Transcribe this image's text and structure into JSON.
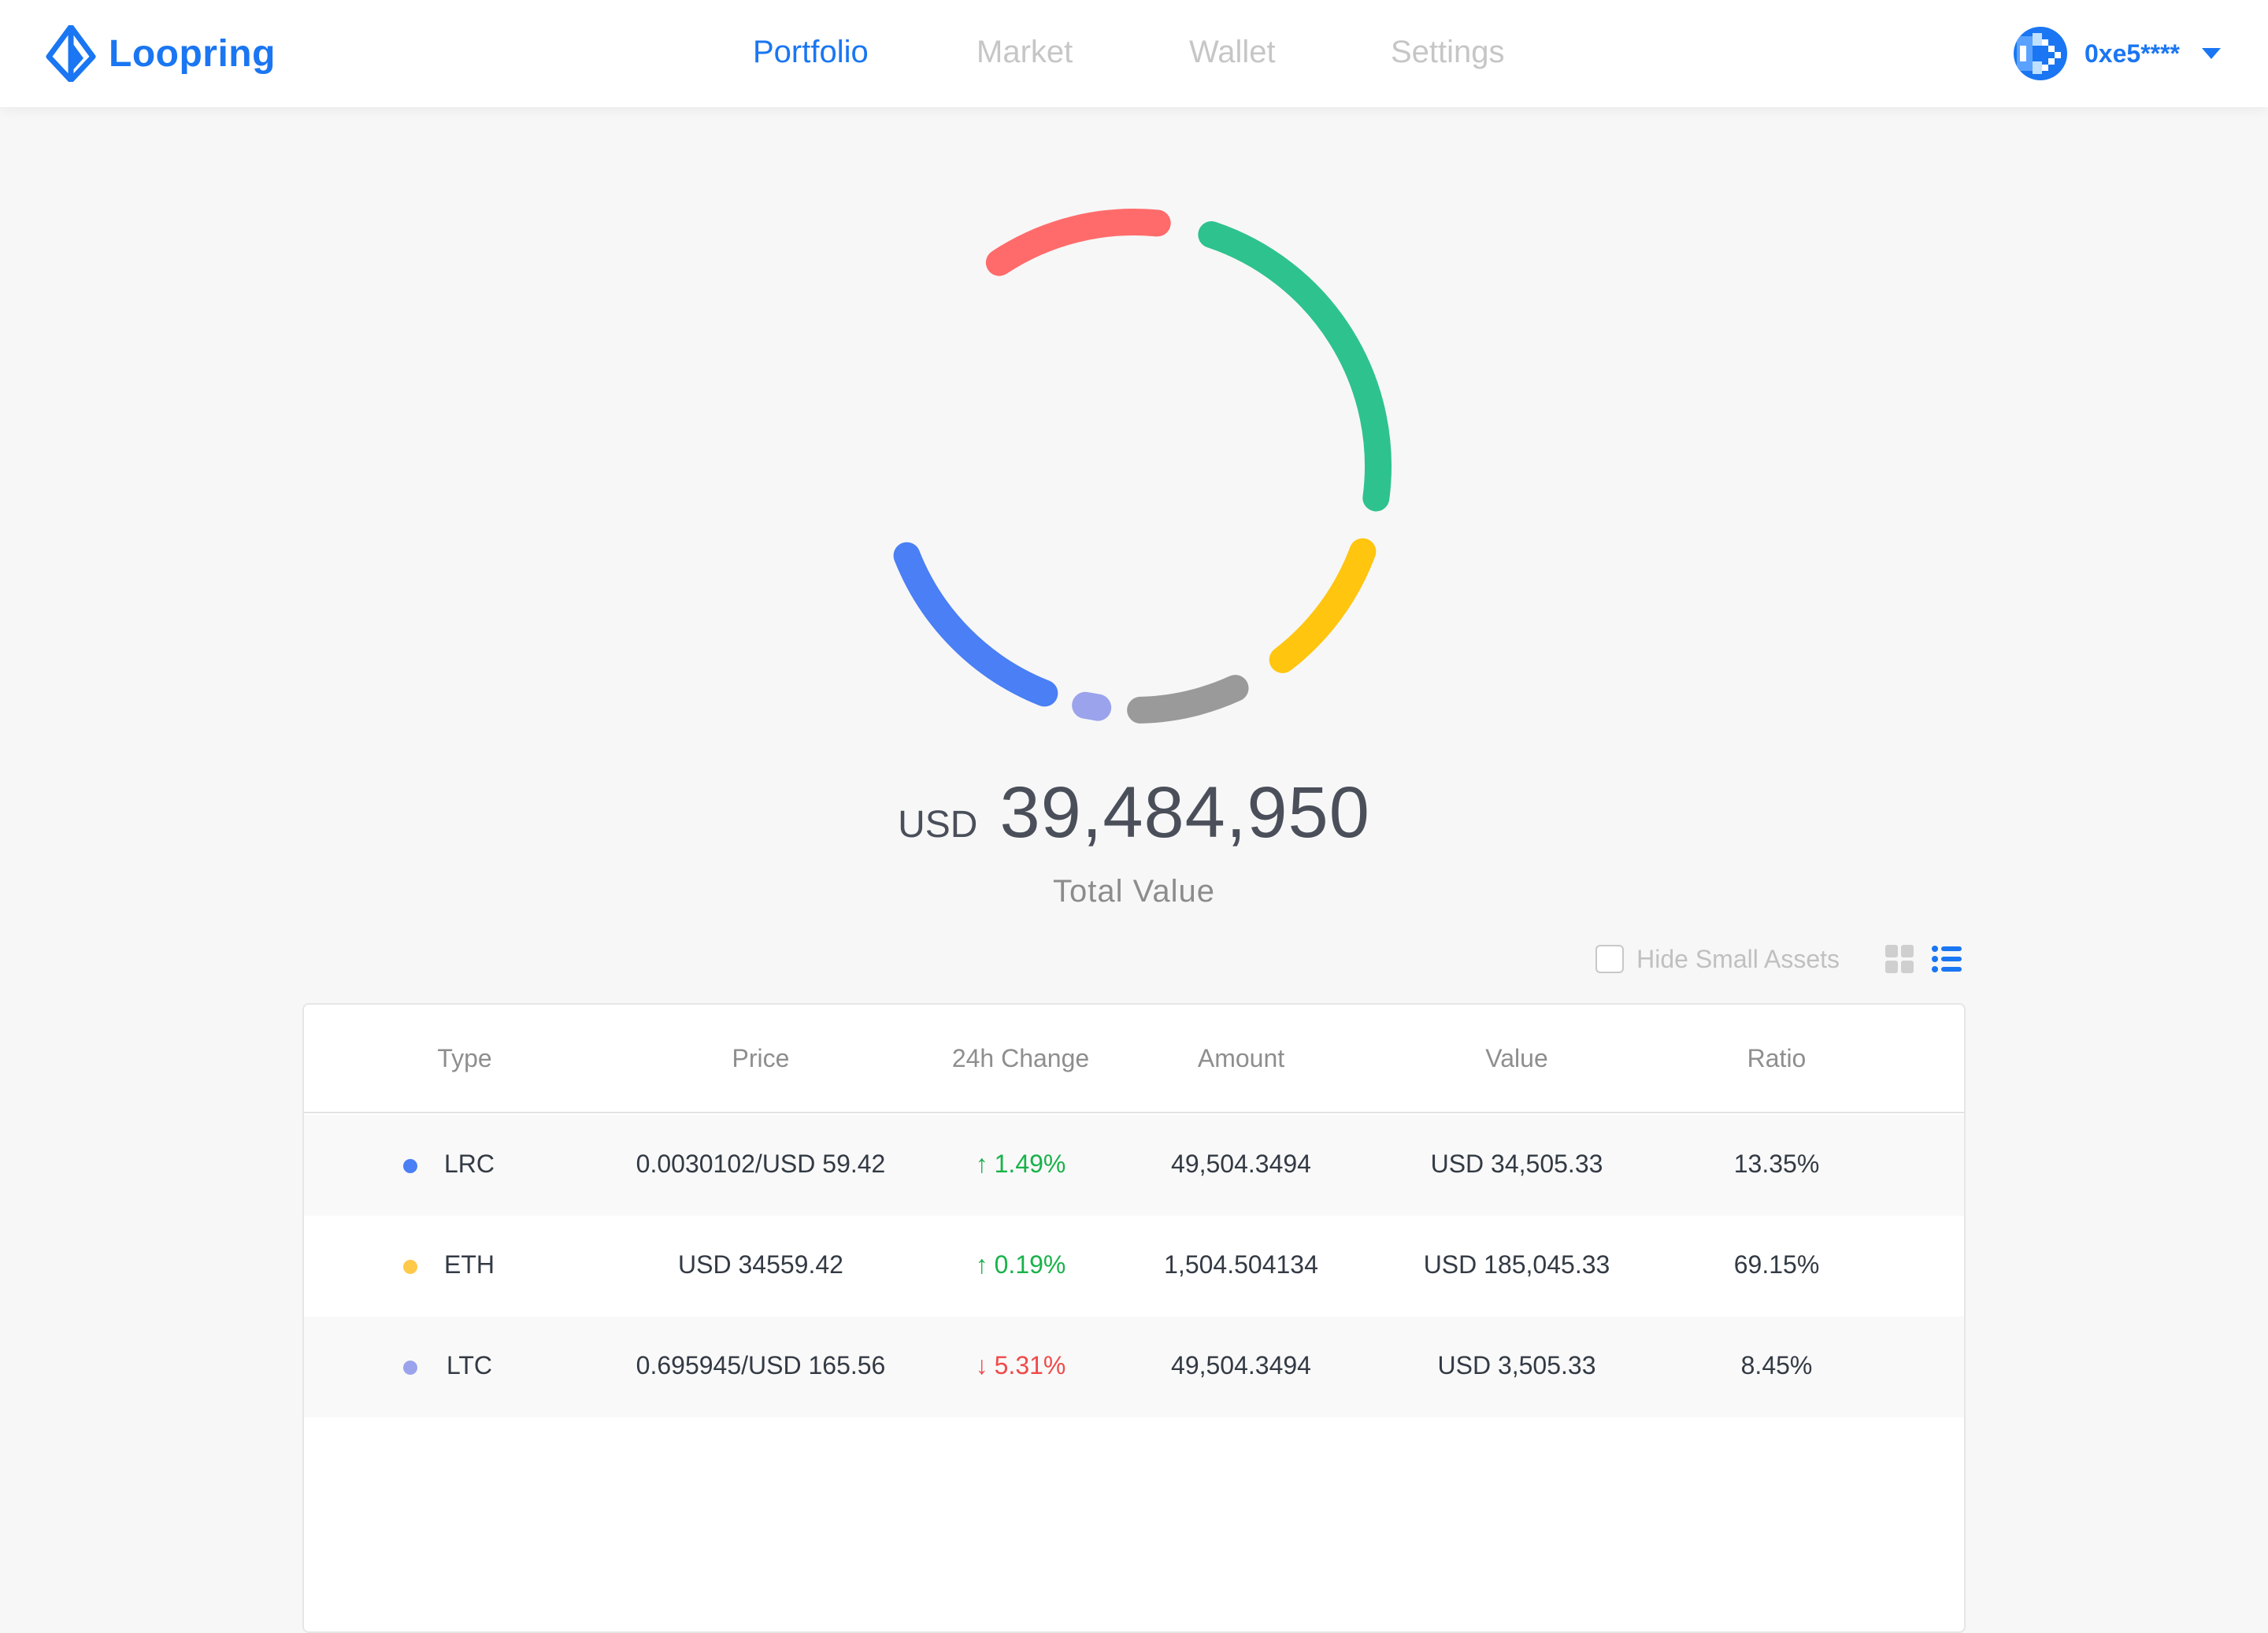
{
  "brand": {
    "name": "Loopring",
    "color": "#1a76f2"
  },
  "nav": {
    "items": [
      {
        "label": "Portfolio",
        "active": true
      },
      {
        "label": "Market",
        "active": false
      },
      {
        "label": "Wallet",
        "active": false
      },
      {
        "label": "Settings",
        "active": false
      }
    ]
  },
  "account": {
    "address": "0xe5****",
    "avatar_icon": "pixel-avatar-icon"
  },
  "chart_data": {
    "type": "pie",
    "style": "donut",
    "series": [
      {
        "color": "#ff6b6b",
        "sweep_deg": 52
      },
      {
        "color": "#2ec28e",
        "sweep_deg": 92
      },
      {
        "color": "#ffc50f",
        "sweep_deg": 45
      },
      {
        "color": "#9a9a9a",
        "sweep_deg": 36
      },
      {
        "color": "#9ba3ec",
        "sweep_deg": 10
      },
      {
        "color": "#4a7ff5",
        "sweep_deg": 60
      }
    ]
  },
  "total": {
    "currency": "USD",
    "amount": "39,484,950",
    "label": "Total Value"
  },
  "controls": {
    "hide_small_label": "Hide Small Assets",
    "hide_small_checked": false,
    "view_mode": "list"
  },
  "table": {
    "headers": {
      "type": "Type",
      "price": "Price",
      "change": "24h Change",
      "amount": "Amount",
      "value": "Value",
      "ratio": "Ratio"
    },
    "rows": [
      {
        "type": "LRC",
        "dot_color": "#4a7ff5",
        "price": "0.0030102/USD 59.42",
        "change": "1.49%",
        "direction": "up",
        "amount": "49,504.3494",
        "value": "USD 34,505.33",
        "ratio": "13.35%"
      },
      {
        "type": "ETH",
        "dot_color": "#ffc94a",
        "price": "USD 34559.42",
        "change": "0.19%",
        "direction": "up",
        "amount": "1,504.504134",
        "value": "USD 185,045.33",
        "ratio": "69.15%"
      },
      {
        "type": "LTC",
        "dot_color": "#9ba3ec",
        "price": "0.695945/USD 165.56",
        "change": "5.31%",
        "direction": "down",
        "amount": "49,504.3494",
        "value": "USD 3,505.33",
        "ratio": "8.45%"
      }
    ]
  }
}
